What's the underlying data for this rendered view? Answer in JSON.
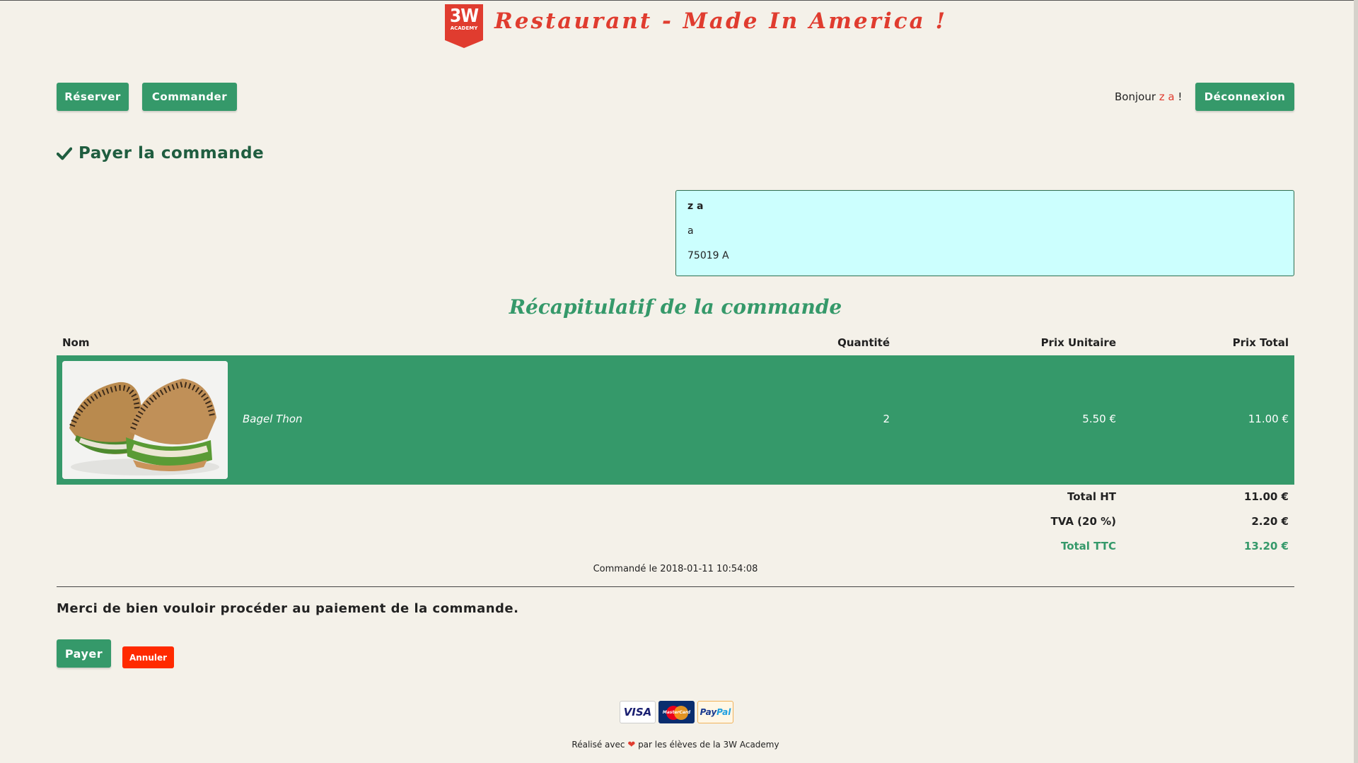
{
  "header": {
    "logo_big": "3W",
    "logo_small": "ACADEMY",
    "site_title": "Restaurant - Made In America !"
  },
  "nav": {
    "reserver": "Réserver",
    "commander": "Commander",
    "greeting_prefix": "Bonjour",
    "username": "z a",
    "greeting_suffix": "!",
    "deconnexion": "Déconnexion"
  },
  "section_title": "Payer la commande",
  "address": {
    "name": "z a",
    "line1": "a",
    "line2": "75019 A"
  },
  "recap_title": "Récapitulatif de la commande",
  "table": {
    "headers": {
      "nom": "Nom",
      "quantite": "Quantité",
      "prix_unitaire": "Prix Unitaire",
      "prix_total": "Prix Total"
    },
    "rows": [
      {
        "name": "Bagel Thon",
        "quantity": "2",
        "unit_price": "5.50 €",
        "total": "11.00 €"
      }
    ]
  },
  "totals": {
    "ht_label": "Total HT",
    "ht_value": "11.00 €",
    "tva_label": "TVA (20 %)",
    "tva_value": "2.20 €",
    "ttc_label": "Total TTC",
    "ttc_value": "13.20 €"
  },
  "ordered_at": "Commandé le 2018-01-11 10:54:08",
  "payment_message": "Merci de bien vouloir procéder au paiement de la commande.",
  "actions": {
    "payer": "Payer",
    "annuler": "Annuler"
  },
  "footer": {
    "cards": {
      "visa": "VISA",
      "mastercard": "MasterCard",
      "paypal_a": "Pay",
      "paypal_b": "Pal"
    },
    "credits_prefix": "Réalisé avec",
    "credits_suffix": "par les élèves de la 3W Academy"
  },
  "colors": {
    "accent_green": "#35996a",
    "brand_red": "#e03c2f",
    "address_bg": "#ccfffe",
    "cancel_red": "#ff2a00"
  }
}
